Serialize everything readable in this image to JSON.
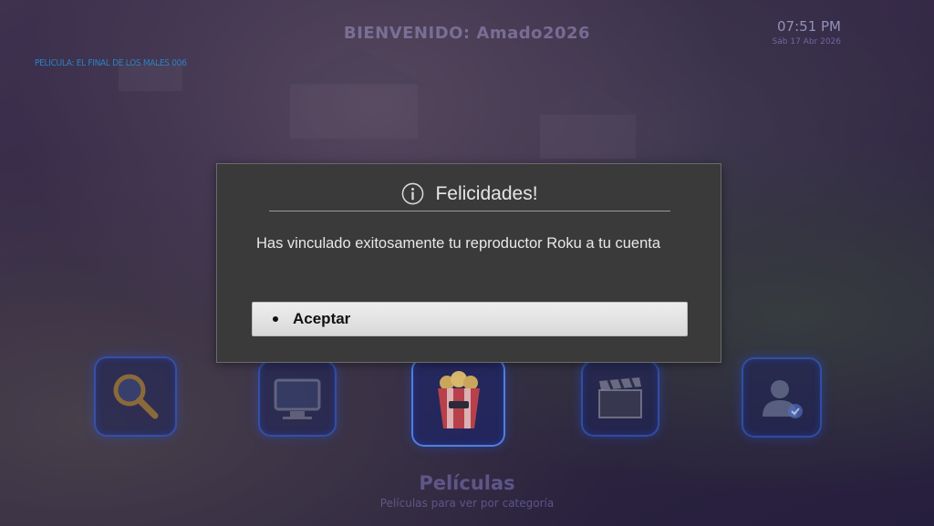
{
  "header": {
    "welcome": "BIENVENIDO: Amado2026",
    "time": "07:51 PM",
    "date": "Sáb 17 Abr 2026"
  },
  "ticker": {
    "text": "PELICULA: EL FINAL DE LOS MALES 006"
  },
  "dialog": {
    "title": "Felicidades!",
    "message": "Has vinculado exitosamente tu reproductor Roku a tu cuenta",
    "accept_label": "Aceptar"
  },
  "menu": {
    "items": [
      {
        "icon": "search-icon"
      },
      {
        "icon": "tv-icon"
      },
      {
        "icon": "popcorn-icon"
      },
      {
        "icon": "clapperboard-icon"
      },
      {
        "icon": "account-icon"
      }
    ],
    "selected_title": "Películas",
    "selected_subtitle": "Películas para ver por categoría"
  }
}
